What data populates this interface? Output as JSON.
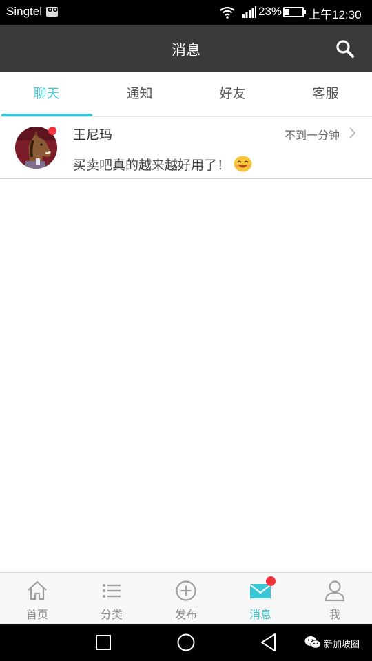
{
  "status_bar": {
    "carrier": "Singtel",
    "battery_percent": "23%",
    "battery_level": 0.23,
    "time": "上午12:30"
  },
  "header": {
    "title": "消息"
  },
  "tabs": [
    {
      "label": "聊天",
      "active": true
    },
    {
      "label": "通知",
      "active": false
    },
    {
      "label": "好友",
      "active": false
    },
    {
      "label": "客服",
      "active": false
    }
  ],
  "chats": [
    {
      "name": "王尼玛",
      "time": "不到一分钟",
      "message": "买卖吧真的越来越好用了！",
      "unread": true
    }
  ],
  "bottom_nav": [
    {
      "label": "首页",
      "icon": "home-icon",
      "active": false
    },
    {
      "label": "分类",
      "icon": "list-icon",
      "active": false
    },
    {
      "label": "发布",
      "icon": "plus-circle-icon",
      "active": false
    },
    {
      "label": "消息",
      "icon": "mail-icon",
      "active": true,
      "badge": true
    },
    {
      "label": "我",
      "icon": "person-icon",
      "active": false
    }
  ],
  "watermark": {
    "text": "新加坡圈"
  },
  "colors": {
    "accent": "#38c7d4",
    "header_bg": "#3a3a3a",
    "badge": "#f2323c"
  }
}
